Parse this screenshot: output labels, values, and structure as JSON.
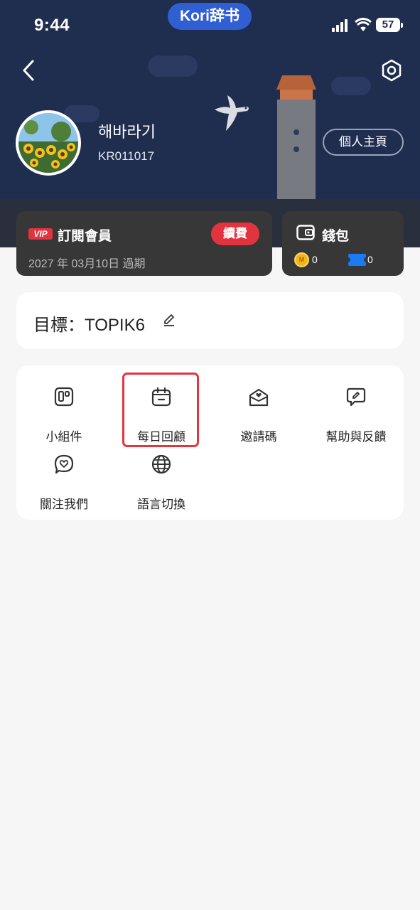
{
  "status_bar": {
    "time": "9:44",
    "app_name": "Kori辞书",
    "battery": "57"
  },
  "header": {
    "back_icon": "chevron-left-icon",
    "settings_icon": "gear-icon",
    "username": "해바라기",
    "user_id": "KR011017",
    "profile_button": "個人主頁",
    "background_color": "#1f2d4f"
  },
  "vip": {
    "badge": "VIP",
    "title": "訂閱會員",
    "renew_button": "續費",
    "expiry": "2027 年 03月10日 過期",
    "accent_color": "#e2343e"
  },
  "wallet": {
    "title": "錢包",
    "coin_count": "0",
    "coin_symbol": "M",
    "ticket_count": "0"
  },
  "goal": {
    "text": "目標：TOPIK6",
    "edit_icon": "pencil-icon"
  },
  "menu": {
    "items": [
      {
        "label": "小組件",
        "icon": "widget-icon"
      },
      {
        "label": "每日回顧",
        "icon": "calendar-icon",
        "highlighted": true
      },
      {
        "label": "邀請碼",
        "icon": "envelope-heart-icon"
      },
      {
        "label": "幫助與反饋",
        "icon": "feedback-icon"
      },
      {
        "label": "關注我們",
        "icon": "heart-chat-icon"
      },
      {
        "label": "語言切換",
        "icon": "globe-icon"
      }
    ]
  }
}
